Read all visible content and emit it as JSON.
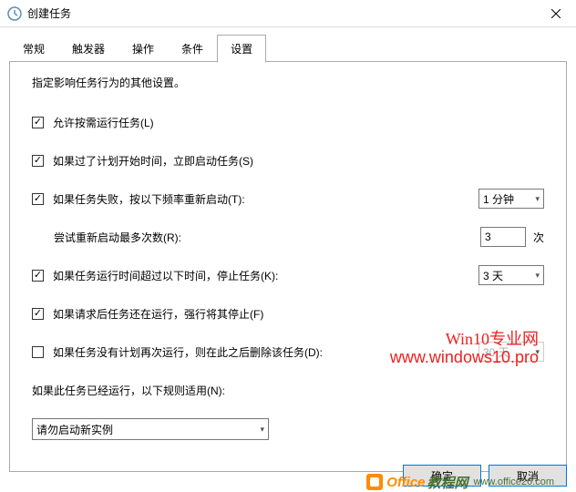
{
  "titlebar": {
    "title": "创建任务"
  },
  "tabs": {
    "items": [
      {
        "label": "常规"
      },
      {
        "label": "触发器"
      },
      {
        "label": "操作"
      },
      {
        "label": "条件"
      },
      {
        "label": "设置"
      }
    ]
  },
  "content": {
    "desc": "指定影响任务行为的其他设置。",
    "allowOnDemand": "允许按需运行任务(L)",
    "runAfterMissed": "如果过了计划开始时间，立即启动任务(S)",
    "restartIfFail": "如果任务失败，按以下频率重新启动(T):",
    "restartInterval": "1 分钟",
    "retryCountLabel": "尝试重新启动最多次数(R):",
    "retryCount": "3",
    "retryUnit": "次",
    "stopIfLong": "如果任务运行时间超过以下时间，停止任务(K):",
    "stopDuration": "3 天",
    "forceStop": "如果请求后任务还在运行，强行将其停止(F)",
    "deleteIfNoSchedule": "如果任务没有计划再次运行，则在此之后删除该任务(D):",
    "deleteDuration": "30 天",
    "ruleLabel": "如果此任务已经运行，以下规则适用(N):",
    "ruleValue": "请勿启动新实例"
  },
  "footer": {
    "ok": "确定",
    "cancel": "取消"
  },
  "watermark": {
    "line1": "Win10专业网",
    "line2": "www.windows10.pro",
    "officeText": "Office",
    "officeSuffix": "教程网",
    "officeUrl": "www.office26.com"
  }
}
